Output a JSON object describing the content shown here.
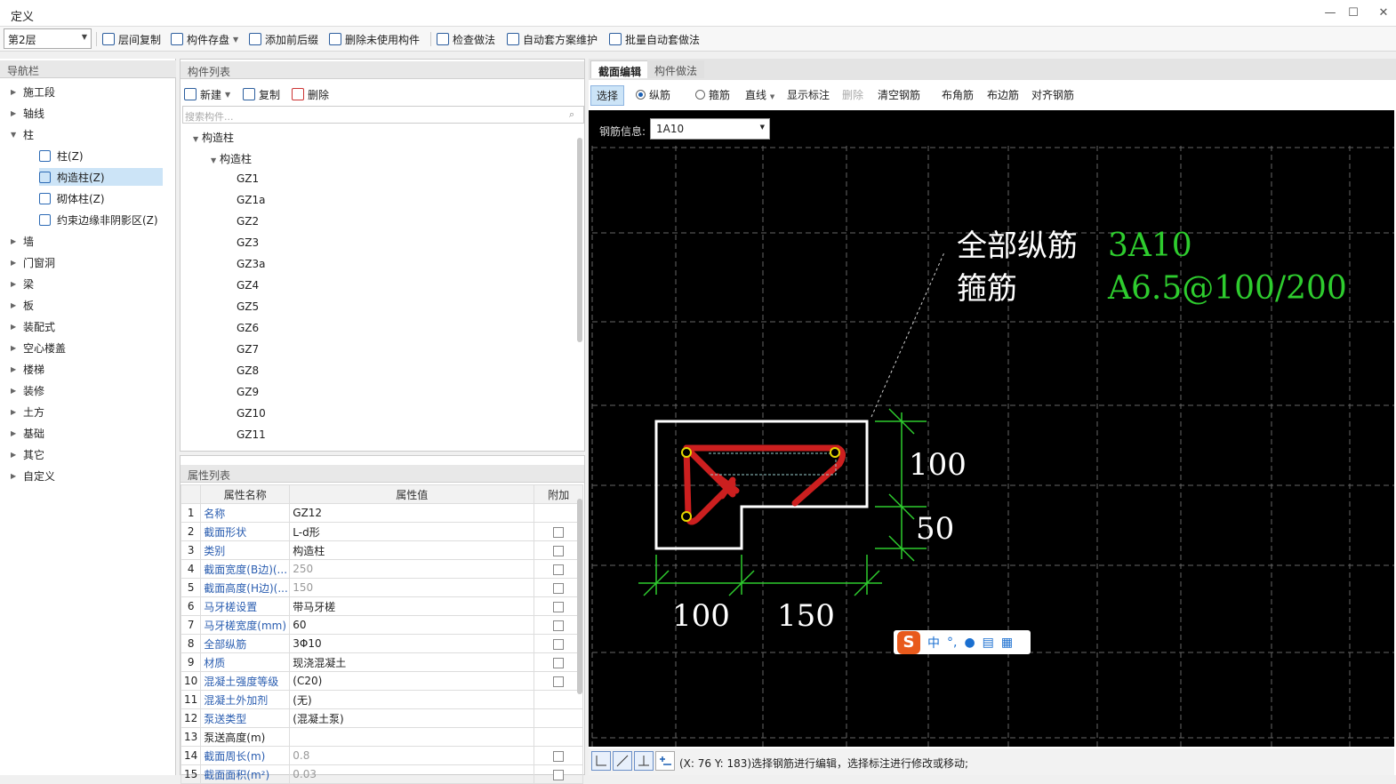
{
  "window": {
    "title": "定义",
    "min": "—",
    "max": "☐",
    "close": "✕"
  },
  "toolbar": {
    "floor": "第2层",
    "buttons": [
      "层间复制",
      "构件存盘",
      "添加前后缀",
      "删除未使用构件",
      "检查做法",
      "自动套方案维护",
      "批量自动套做法"
    ]
  },
  "nav": {
    "header": "导航栏",
    "items": [
      "施工段",
      "轴线",
      "柱",
      "柱(Z)",
      "构造柱(Z)",
      "砌体柱(Z)",
      "约束边缘非阴影区(Z)",
      "墙",
      "门窗洞",
      "梁",
      "板",
      "装配式",
      "空心楼盖",
      "楼梯",
      "装修",
      "土方",
      "基础",
      "其它",
      "自定义"
    ]
  },
  "complist": {
    "header": "构件列表",
    "new_label": "新建",
    "copy_label": "复制",
    "delete_label": "删除",
    "search_placeholder": "搜索构件...",
    "group": "构造柱",
    "subgroup": "构造柱",
    "items": [
      "GZ1",
      "GZ1a",
      "GZ2",
      "GZ3",
      "GZ3a",
      "GZ4",
      "GZ5",
      "GZ6",
      "GZ7",
      "GZ8",
      "GZ9",
      "GZ10",
      "GZ11"
    ]
  },
  "props": {
    "header": "属性列表",
    "col_name": "属性名称",
    "col_value": "属性值",
    "col_add": "附加",
    "rows": [
      {
        "n": "1",
        "name": "名称",
        "value": "GZ12",
        "chk": false
      },
      {
        "n": "2",
        "name": "截面形状",
        "value": "L-d形",
        "chk": true
      },
      {
        "n": "3",
        "name": "类别",
        "value": "构造柱",
        "chk": true
      },
      {
        "n": "4",
        "name": "截面宽度(B边)(...",
        "value": "250",
        "chk": true,
        "gray": true
      },
      {
        "n": "5",
        "name": "截面高度(H边)(...",
        "value": "150",
        "chk": true,
        "gray": true
      },
      {
        "n": "6",
        "name": "马牙槎设置",
        "value": "带马牙槎",
        "chk": true
      },
      {
        "n": "7",
        "name": "马牙槎宽度(mm)",
        "value": "60",
        "chk": true
      },
      {
        "n": "8",
        "name": "全部纵筋",
        "value": "3Φ10",
        "chk": true
      },
      {
        "n": "9",
        "name": "材质",
        "value": "现浇混凝土",
        "chk": true
      },
      {
        "n": "10",
        "name": "混凝土强度等级",
        "value": "(C20)",
        "chk": true
      },
      {
        "n": "11",
        "name": "混凝土外加剂",
        "value": "(无)",
        "chk": false
      },
      {
        "n": "12",
        "name": "泵送类型",
        "value": "(混凝土泵)",
        "chk": false
      },
      {
        "n": "13",
        "name": "泵送高度(m)",
        "value": "",
        "chk": false,
        "black": true
      },
      {
        "n": "14",
        "name": "截面周长(m)",
        "value": "0.8",
        "chk": true,
        "gray": true
      },
      {
        "n": "15",
        "name": "截面面积(m²)",
        "value": "0.03",
        "chk": true,
        "gray": true
      }
    ]
  },
  "editor": {
    "tabs": [
      "截面编辑",
      "构件做法"
    ],
    "tools": {
      "select": "选择",
      "long": "纵筋",
      "stirrup": "箍筋",
      "line": "直线",
      "show": "显示标注",
      "delete": "删除",
      "clear": "清空钢筋",
      "corner": "布角筋",
      "edge": "布边筋",
      "align": "对齐钢筋"
    },
    "rebar_info_label": "钢筋信息:",
    "rebar_info_value": "1A10",
    "annotation": {
      "l1_label": "全部纵筋",
      "l1_value": "3A10",
      "l2_label": "箍筋",
      "l2_value": "A6.5@100/200"
    },
    "dims": {
      "h1": "100",
      "h2": "50",
      "w1": "100",
      "w2": "150"
    },
    "colors": {
      "green": "#2ecc2e",
      "red": "#cc1f1f",
      "yellow": "#e6d800"
    }
  },
  "status": {
    "text": "(X: 76 Y: 183)选择钢筋进行编辑，选择标注进行修改或移动;"
  },
  "ime": {
    "logo": "S",
    "zh": "中",
    "punct": "°,"
  }
}
